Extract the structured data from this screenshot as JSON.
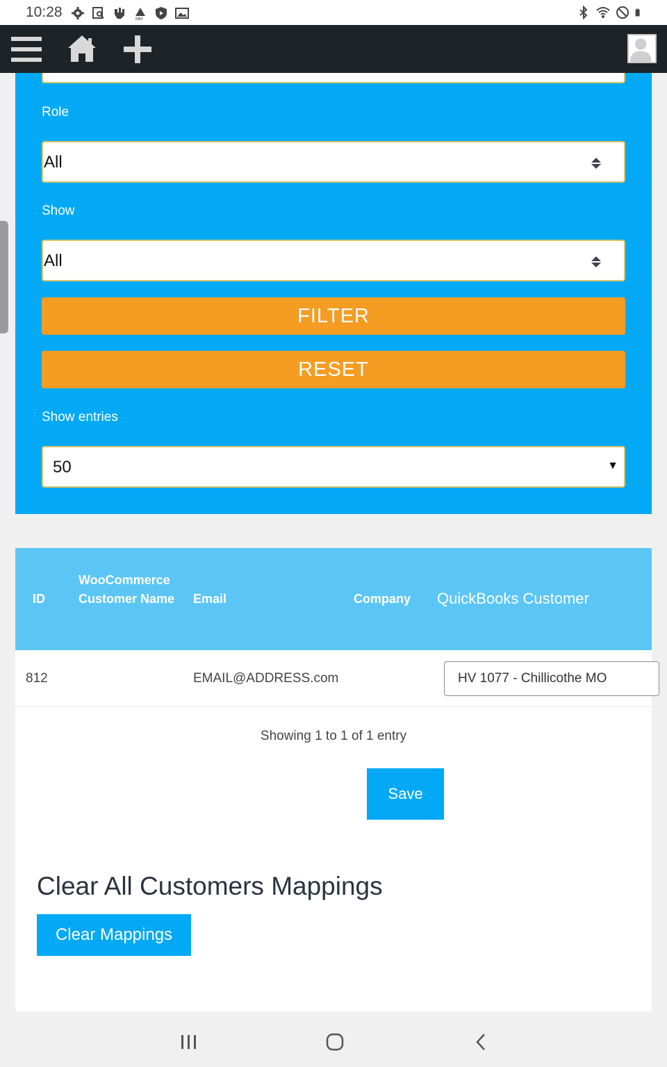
{
  "status_bar": {
    "time": "10:28",
    "left_icons": [
      "settings-icon",
      "screenshot-search-icon",
      "hand-icon",
      "drive-icon",
      "shield-icon",
      "image-icon"
    ],
    "right_icons": [
      "bluetooth-icon",
      "wifi-icon",
      "do-not-disturb-icon",
      "battery-icon"
    ]
  },
  "app_bar": {
    "icons": [
      "hamburger-menu-icon",
      "home-icon",
      "plus-icon",
      "avatar-icon"
    ],
    "background": "#1d2327"
  },
  "filter": {
    "role_label": "Role",
    "role_value": "All",
    "show_label": "Show",
    "show_value": "All",
    "filter_button": "FILTER",
    "reset_button": "RESET",
    "entries_label": "Show entries",
    "entries_value": "50",
    "panel_color": "#03a9f4",
    "button_color": "#f59c22"
  },
  "table": {
    "headers": {
      "id": "ID",
      "woo_name": "WooCommerce Customer Name",
      "email": "Email",
      "company": "Company",
      "qb_customer": "QuickBooks Customer"
    },
    "rows": [
      {
        "id": "812",
        "woo_name": "",
        "email": "EMAIL@ADDRESS.com",
        "company": "",
        "qb_customer": "HV 1077 - Chillicothe MO"
      }
    ],
    "info": "Showing 1 to 1 of 1 entry",
    "save_button": "Save",
    "header_color": "#5bc6f5"
  },
  "clear_section": {
    "heading": "Clear All Customers Mappings",
    "button": "Clear Mappings"
  },
  "nav_bar": {
    "icons": [
      "recents-icon",
      "home-circle-icon",
      "back-icon"
    ]
  }
}
